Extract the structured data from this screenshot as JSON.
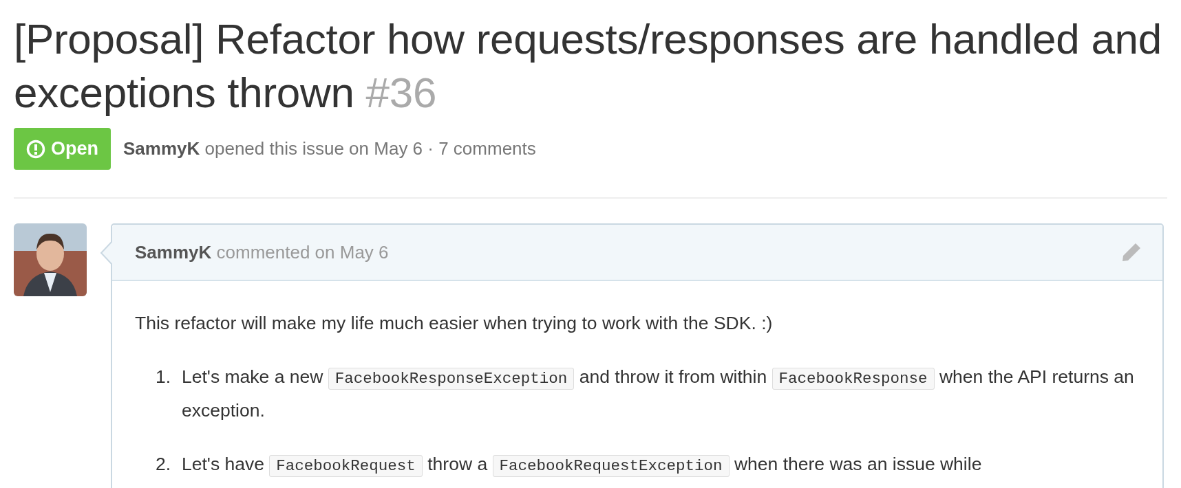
{
  "issue": {
    "title": "[Proposal] Refactor how requests/responses are handled and exceptions thrown",
    "number": "#36",
    "open": true,
    "state_label": "Open",
    "author": "SammyK",
    "meta": "opened this issue on May 6 · 7 comments"
  },
  "comment": {
    "author": "SammyK",
    "meta": "commented on May 6",
    "intro": "This refactor will make my life much easier when trying to work with the SDK. :)",
    "items": [
      {
        "number": "1.",
        "segments": [
          {
            "kind": "text",
            "text": "Let's make a new "
          },
          {
            "kind": "code",
            "text": "FacebookResponseException"
          },
          {
            "kind": "text",
            "text": " and throw it from within "
          },
          {
            "kind": "code",
            "text": "FacebookResponse"
          },
          {
            "kind": "text",
            "text": " when the API returns an exception."
          }
        ]
      },
      {
        "number": "2.",
        "segments": [
          {
            "kind": "text",
            "text": "Let's have "
          },
          {
            "kind": "code",
            "text": "FacebookRequest"
          },
          {
            "kind": "text",
            "text": " throw a "
          },
          {
            "kind": "code",
            "text": "FacebookRequestException"
          },
          {
            "kind": "text",
            "text": " when there was an issue while"
          }
        ]
      }
    ]
  }
}
